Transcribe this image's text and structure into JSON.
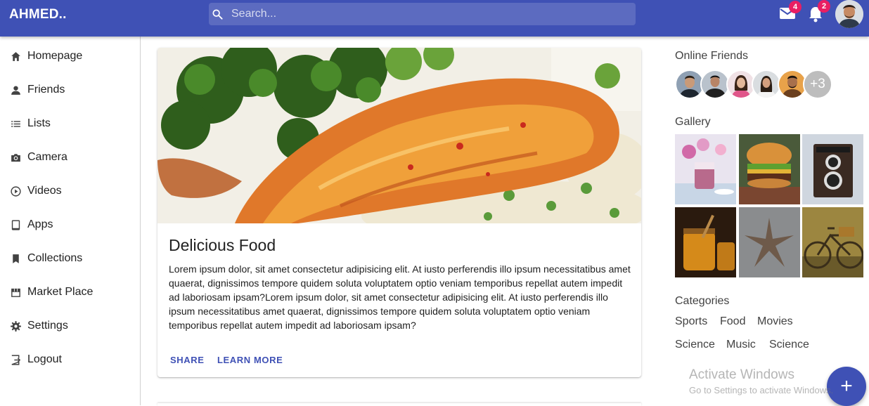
{
  "header": {
    "logo": "AHMED..",
    "search_placeholder": "Search...",
    "mail_count": "4",
    "notification_count": "2"
  },
  "colors": {
    "primary": "#3f51b5",
    "search_bg": "#5c6bc0",
    "badge": "#e91e63"
  },
  "sidebar": {
    "items": [
      {
        "label": "Homepage",
        "icon": "home-icon"
      },
      {
        "label": "Friends",
        "icon": "person-icon"
      },
      {
        "label": "Lists",
        "icon": "list-icon"
      },
      {
        "label": "Camera",
        "icon": "camera-icon"
      },
      {
        "label": "Videos",
        "icon": "play-circle-icon"
      },
      {
        "label": "Apps",
        "icon": "tablet-icon"
      },
      {
        "label": "Collections",
        "icon": "bookmark-icon"
      },
      {
        "label": "Market Place",
        "icon": "storefront-icon"
      },
      {
        "label": "Settings",
        "icon": "gear-icon"
      },
      {
        "label": "Logout",
        "icon": "logout-icon"
      }
    ]
  },
  "post": {
    "title": "Delicious Food",
    "body": "Lorem ipsum dolor, sit amet consectetur adipisicing elit. At iusto perferendis illo ipsum necessitatibus amet quaerat, dignissimos tempore quidem soluta voluptatem optio veniam temporibus repellat autem impedit ad laboriosam ipsam?Lorem ipsum dolor, sit amet consectetur adipisicing elit. At iusto perferendis illo ipsum necessitatibus amet quaerat, dignissimos tempore quidem soluta voluptatem optio veniam temporibus repellat autem impedit ad laboriosam ipsam?",
    "share_label": "SHARE",
    "learn_more_label": "LEARN MORE"
  },
  "rightbar": {
    "online_heading": "Online Friends",
    "more_friends": "+3",
    "gallery_heading": "Gallery",
    "categories_heading": "Categories",
    "categories": [
      "Sports",
      "Food",
      "Movies",
      "Science",
      "Music",
      "Science"
    ]
  },
  "watermark": {
    "line1": "Activate Windows",
    "line2": "Go to Settings to activate Windows."
  },
  "fab_label": "+"
}
